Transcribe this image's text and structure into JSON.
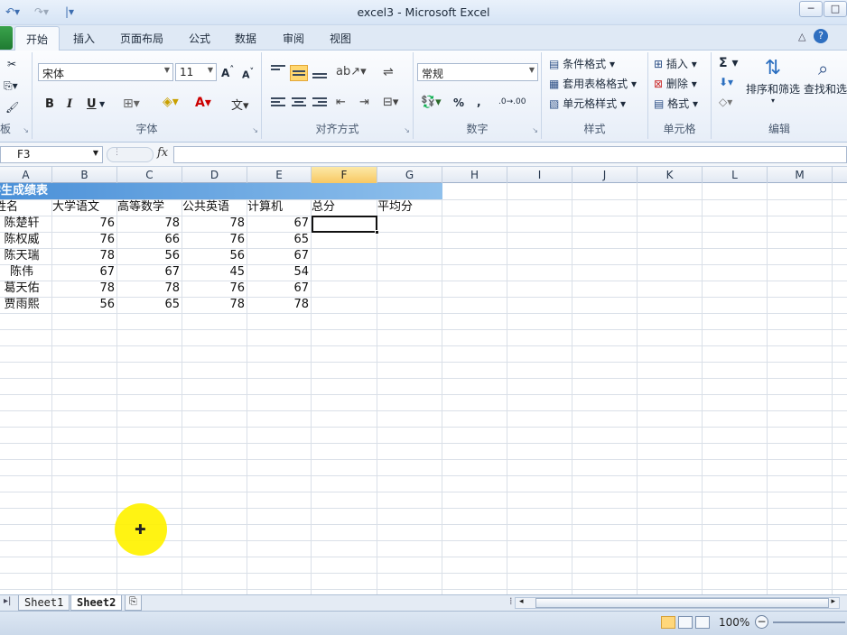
{
  "window": {
    "title": "excel3 - Microsoft Excel"
  },
  "tabs": [
    "开始",
    "插入",
    "页面布局",
    "公式",
    "数据",
    "审阅",
    "视图"
  ],
  "ribbon": {
    "font": {
      "name": "宋体",
      "size": "11",
      "group_label": "字体"
    },
    "alignment": {
      "group_label": "对齐方式"
    },
    "number": {
      "format": "常规",
      "group_label": "数字",
      "percent": "%",
      "comma": ","
    },
    "styles": {
      "conditional": "条件格式",
      "table": "套用表格格式",
      "cell": "单元格样式",
      "group_label": "样式"
    },
    "cells": {
      "insert": "插入",
      "delete": "删除",
      "format": "格式",
      "group_label": "单元格"
    },
    "editing": {
      "sort_filter": "排序和筛选",
      "find_select": "查找和选",
      "group_label": "编辑"
    },
    "clipboard": {
      "group_label": "板"
    }
  },
  "formula_bar": {
    "name_box": "F3",
    "fx": "fx",
    "content": ""
  },
  "columns": [
    "A",
    "B",
    "C",
    "D",
    "E",
    "F",
    "G",
    "H",
    "I",
    "J",
    "K",
    "L",
    "M"
  ],
  "sheet": {
    "banner": "学生成绩表",
    "headers": [
      "姓名",
      "大学语文",
      "高等数学",
      "公共英语",
      "计算机",
      "总分",
      "平均分"
    ],
    "rows": [
      {
        "name": "陈楚轩",
        "scores": [
          76,
          78,
          78,
          67
        ]
      },
      {
        "name": "陈权威",
        "scores": [
          76,
          66,
          76,
          65
        ]
      },
      {
        "name": "陈天瑞",
        "scores": [
          78,
          56,
          56,
          67
        ]
      },
      {
        "name": "陈伟",
        "scores": [
          67,
          67,
          45,
          54
        ]
      },
      {
        "name": "葛天佑",
        "scores": [
          78,
          78,
          76,
          67
        ]
      },
      {
        "name": "贾雨熙",
        "scores": [
          56,
          65,
          78,
          78
        ]
      }
    ]
  },
  "sheet_tabs": [
    "Sheet1",
    "Sheet2"
  ],
  "active_sheet": "Sheet2",
  "status": {
    "zoom": "100%"
  },
  "colors": {
    "accent": "#4a90d8",
    "selection": "#f8c862",
    "cursor_highlight": "#fff200"
  }
}
